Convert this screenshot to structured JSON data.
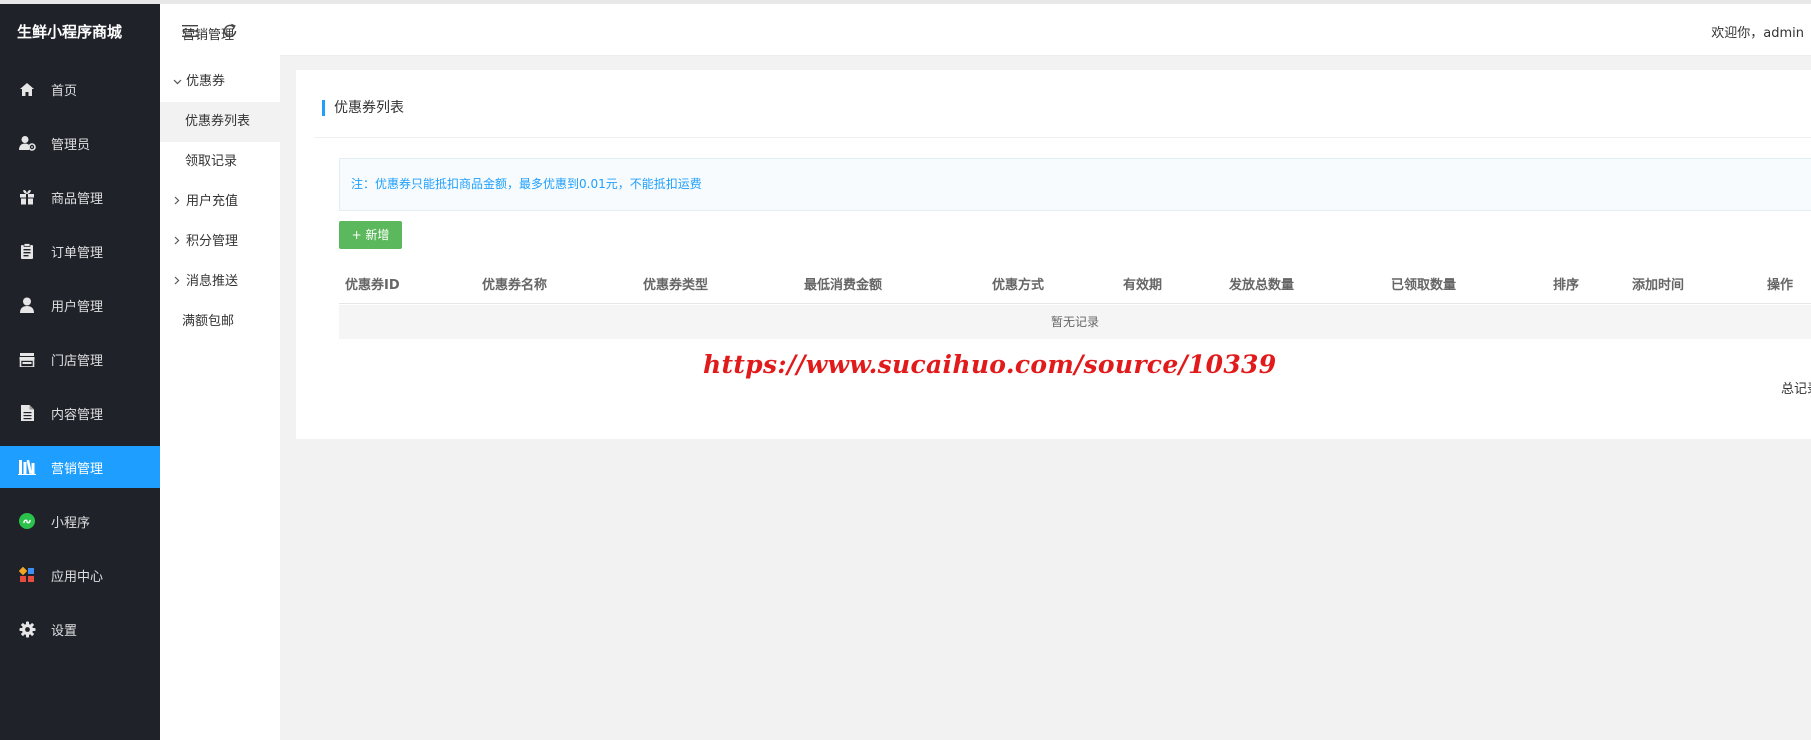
{
  "app": {
    "brand": "生鲜小程序商城"
  },
  "sidebar": {
    "items": [
      {
        "label": "首页",
        "icon": "home-icon",
        "active": false
      },
      {
        "label": "管理员",
        "icon": "admin-user-icon",
        "active": false
      },
      {
        "label": "商品管理",
        "icon": "gift-icon",
        "active": false
      },
      {
        "label": "订单管理",
        "icon": "clipboard-icon",
        "active": false
      },
      {
        "label": "用户管理",
        "icon": "user-icon",
        "active": false
      },
      {
        "label": "门店管理",
        "icon": "store-icon",
        "active": false
      },
      {
        "label": "内容管理",
        "icon": "document-icon",
        "active": false
      },
      {
        "label": "营销管理",
        "icon": "books-icon",
        "active": true
      },
      {
        "label": "小程序",
        "icon": "miniprogram-icon",
        "active": false
      },
      {
        "label": "应用中心",
        "icon": "apps-icon",
        "active": false
      },
      {
        "label": "设置",
        "icon": "gear-icon",
        "active": false
      }
    ]
  },
  "subnav": {
    "title": "营销管理",
    "coupon_group": "优惠券",
    "coupon_list": "优惠券列表",
    "claim_records": "领取记录",
    "recharge_group": "用户充值",
    "points_group": "积分管理",
    "push_group": "消息推送",
    "free_shipping": "满额包邮"
  },
  "header": {
    "welcome": "欢迎你，admin",
    "icons": [
      "collapse-menu-icon",
      "refresh-icon"
    ]
  },
  "main": {
    "title": "优惠券列表",
    "notice": "注：优惠券只能抵扣商品金额，最多优惠到0.01元，不能抵扣运费",
    "add_button": "+ 新增",
    "columns": [
      "优惠券ID",
      "优惠券名称",
      "优惠券类型",
      "最低消费金额",
      "优惠方式",
      "有效期",
      "发放总数量",
      "已领取数量",
      "排序",
      "添加时间",
      "操作"
    ],
    "empty_text": "暂无记录",
    "total_text": "总记录"
  },
  "watermark": "https://www.sucaihuo.com/source/10339",
  "colors": {
    "accent": "#1e9fff",
    "sidebar_bg": "#20222a",
    "add_button": "#5cb85c",
    "watermark": "#e11b1b"
  }
}
